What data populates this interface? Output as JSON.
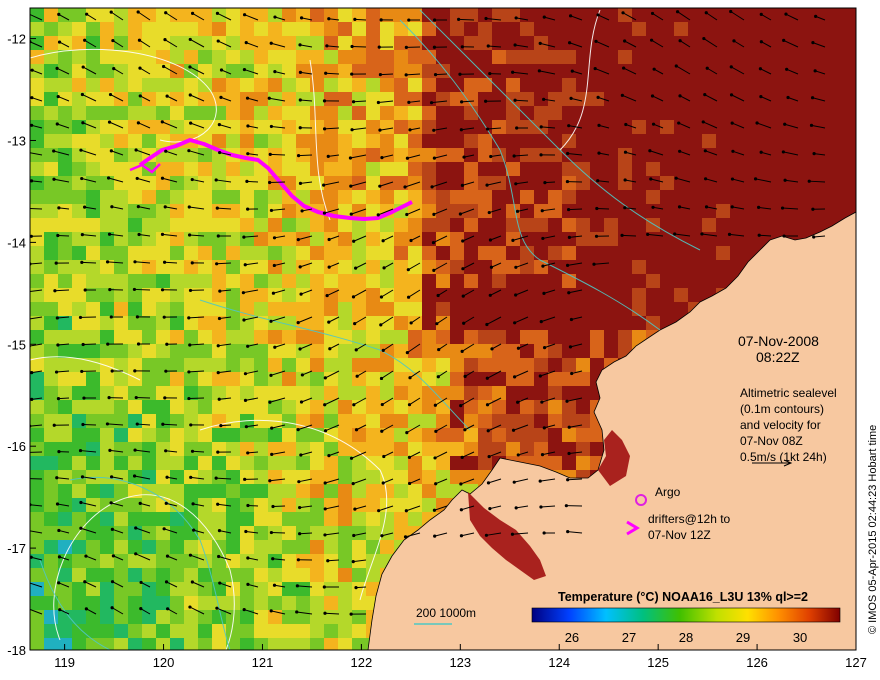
{
  "map": {
    "lon_ticks": [
      "119",
      "120",
      "121",
      "122",
      "123",
      "124",
      "125",
      "126",
      "127"
    ],
    "lat_ticks": [
      "-12",
      "-13",
      "-14",
      "-15",
      "-16",
      "-17",
      "-18"
    ],
    "lon_range": [
      118.65,
      127.0
    ],
    "lat_range": [
      -18.0,
      -11.7
    ]
  },
  "annotation": {
    "date": "07-Nov-2008",
    "time": "08:22Z",
    "altimetry_lines": [
      "Altimetric sealevel",
      "(0.1m contours)",
      "and velocity for",
      "07-Nov 08Z",
      "0.5m/s (1kt 24h)"
    ]
  },
  "legend": {
    "argo_label": "Argo",
    "drifters_line1": "drifters@12h to",
    "drifters_line2": "07-Nov 12Z",
    "depth_contours_label": "200  1000m"
  },
  "colorbar": {
    "title": "Temperature (°C) NOAA16_L3U 13% ql>=2",
    "tick_labels": [
      "26",
      "27",
      "28",
      "29",
      "30"
    ],
    "range": [
      25.3,
      30.7
    ],
    "tick_values": [
      26,
      27,
      28,
      29,
      30
    ]
  },
  "credit": "© IMOS 05-Apr-2015 02:44:23 Hobart time",
  "colors": {
    "land": "#f7c8a0",
    "argo": "#e020e0",
    "drifter": "#ff00ff",
    "bathy_contour": "#4fc7c4",
    "sealevel_contour": "#ffffff"
  }
}
